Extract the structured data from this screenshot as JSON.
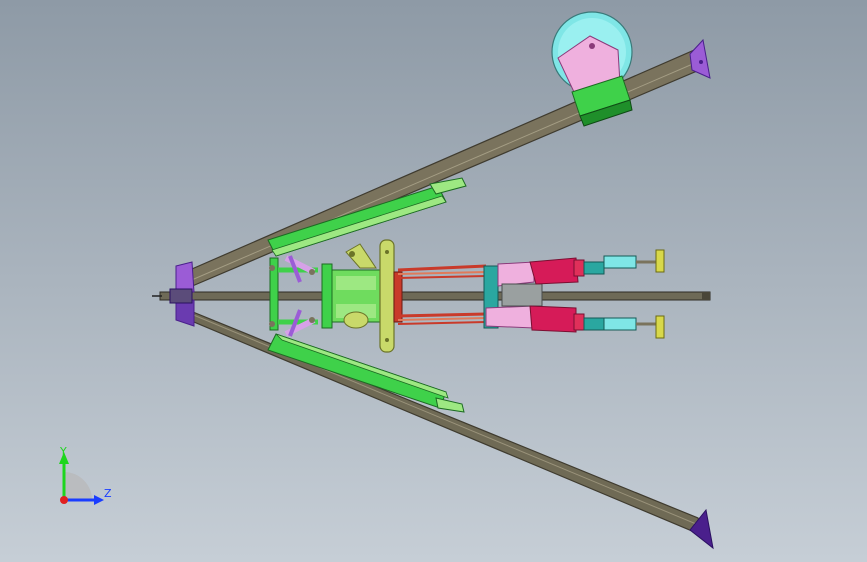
{
  "triad": {
    "y_label": "Y",
    "z_label": "Z"
  },
  "colors": {
    "background_top": "#8e9aa6",
    "background_bottom": "#c6ced6",
    "leg": "#7a735d",
    "leg_edge": "#3f3b2f",
    "center_rod": "#6e6a57",
    "arm_green": "#3fd14a",
    "arm_light_green": "#9de882",
    "yellow_green": "#c9d96a",
    "cyan": "#7fe6e6",
    "pink": "#efb0de",
    "magenta": "#d61b58",
    "red": "#c93a2a",
    "teal": "#2aa7a0",
    "violet": "#9b5cd6",
    "dark_violet": "#4a1f8c",
    "triad_y": "#1ed61e",
    "triad_z": "#1a3dff",
    "triad_origin": "#e02020"
  }
}
